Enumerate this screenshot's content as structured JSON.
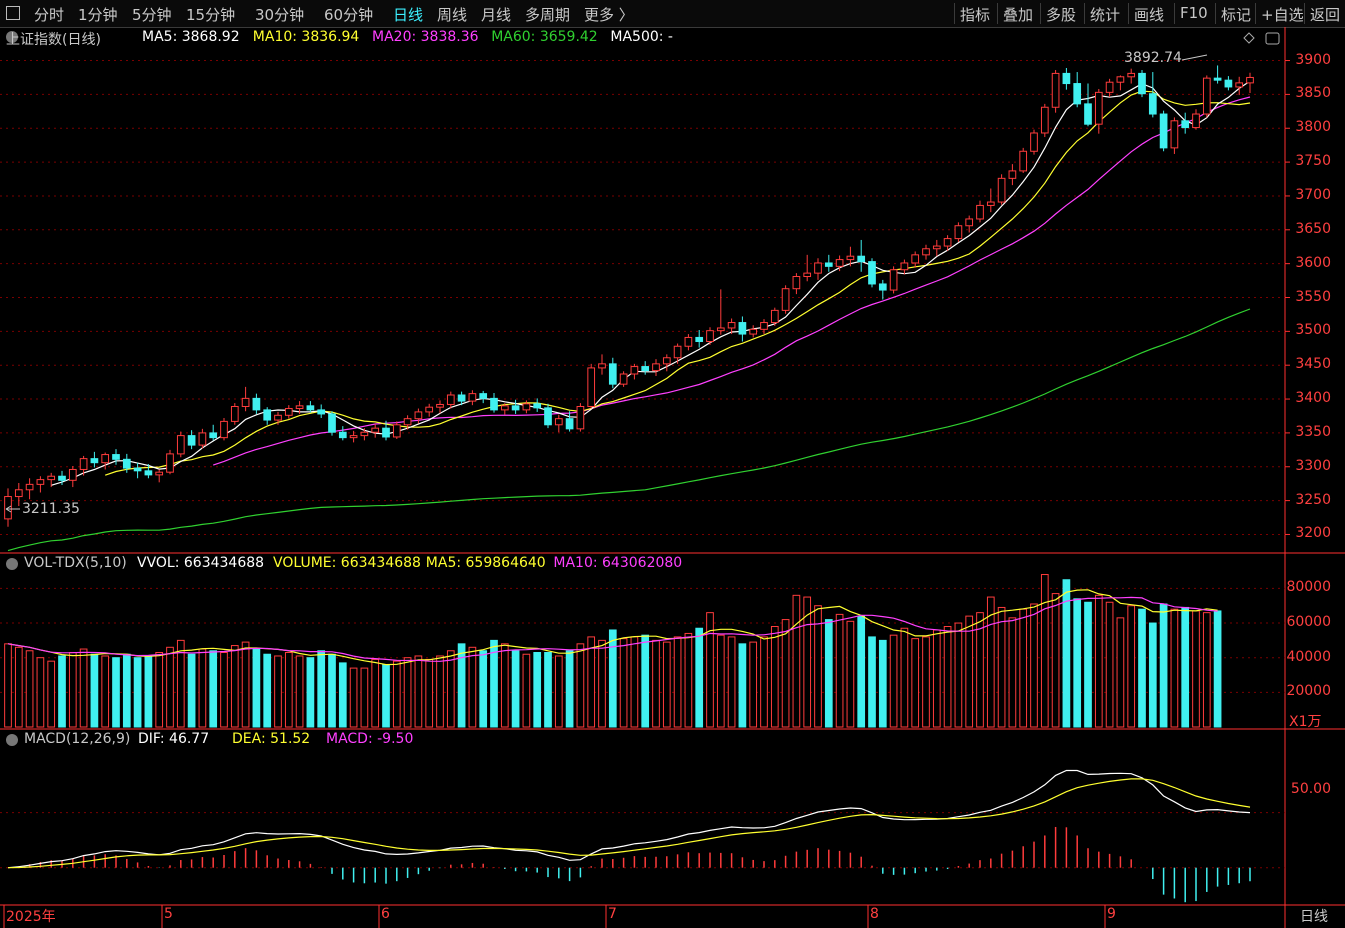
{
  "toolbar": {
    "left_items": [
      "分时",
      "1分钟",
      "5分钟",
      "15分钟",
      "30分钟",
      "60分钟",
      "日线",
      "周线",
      "月线",
      "多周期",
      "更多 〉"
    ],
    "active": "日线",
    "right_items": [
      "指标",
      "叠加",
      "多股",
      "统计",
      "画线",
      "F10",
      "标记",
      "+自选",
      "返回"
    ]
  },
  "main": {
    "title": "上证指数(日线)",
    "ma_labels": [
      {
        "text": "MA5: 3868.92",
        "color": "#ffffff"
      },
      {
        "text": "MA10: 3836.94",
        "color": "#ffff30"
      },
      {
        "text": "MA20: 3838.36",
        "color": "#ff40ff"
      },
      {
        "text": "MA60: 3659.42",
        "color": "#30d030"
      },
      {
        "text": "MA500: -",
        "color": "#ffffff"
      }
    ],
    "low_label": "3211.35",
    "high_label": "3892.74",
    "y_ticks": [
      "3900",
      "3850",
      "3800",
      "3750",
      "3700",
      "3650",
      "3600",
      "3550",
      "3500",
      "3450",
      "3400",
      "3350",
      "3300",
      "3250",
      "3200"
    ]
  },
  "volume": {
    "indicator_label": "VOL-TDX(5,10)",
    "labels": [
      {
        "text": "VVOL: 663434688",
        "color": "#ffffff"
      },
      {
        "text": "VOLUME: 663434688",
        "color": "#ffff30"
      },
      {
        "text": "MA5: 659864640",
        "color": "#ffff30"
      },
      {
        "text": "MA10: 643062080",
        "color": "#ff40ff"
      }
    ],
    "y_ticks": [
      "80000",
      "60000",
      "40000",
      "20000"
    ],
    "unit": "X1万"
  },
  "macd": {
    "indicator_label": "MACD(12,26,9)",
    "labels": [
      {
        "text": "DIF: 46.77",
        "color": "#ffffff"
      },
      {
        "text": "DEA: 51.52",
        "color": "#ffff30"
      },
      {
        "text": "MACD: -9.50",
        "color": "#ff40ff"
      }
    ],
    "y_tick": "50.00"
  },
  "x_axis": {
    "labels": [
      "2025年",
      "5",
      "6",
      "7",
      "8",
      "9"
    ],
    "period": "日线"
  },
  "colors": {
    "up": "#ff3c3c",
    "down": "#40f0f0",
    "grid": "#7a0000",
    "axis": "#ff3030"
  },
  "chart_data": {
    "type": "candlestick",
    "title": "上证指数(日线)",
    "ylim": [
      3180,
      3920
    ],
    "low_label": 3211.35,
    "high_label": 3892.74,
    "candles": [
      [
        3223,
        3268,
        3211.35,
        3256
      ],
      [
        3256,
        3276,
        3242,
        3266
      ],
      [
        3266,
        3283,
        3252,
        3274
      ],
      [
        3274,
        3286,
        3262,
        3281
      ],
      [
        3281,
        3291,
        3270,
        3286
      ],
      [
        3286,
        3294,
        3273,
        3280
      ],
      [
        3280,
        3301,
        3270,
        3296
      ],
      [
        3296,
        3316,
        3287,
        3312
      ],
      [
        3312,
        3322,
        3299,
        3306
      ],
      [
        3306,
        3321,
        3296,
        3318
      ],
      [
        3318,
        3326,
        3303,
        3311
      ],
      [
        3311,
        3319,
        3291,
        3298
      ],
      [
        3298,
        3306,
        3283,
        3294
      ],
      [
        3294,
        3304,
        3283,
        3288
      ],
      [
        3288,
        3296,
        3277,
        3292
      ],
      [
        3292,
        3325,
        3289,
        3319
      ],
      [
        3319,
        3352,
        3314,
        3346
      ],
      [
        3346,
        3354,
        3326,
        3332
      ],
      [
        3332,
        3356,
        3327,
        3350
      ],
      [
        3350,
        3362,
        3339,
        3343
      ],
      [
        3343,
        3372,
        3339,
        3367
      ],
      [
        3367,
        3394,
        3362,
        3389
      ],
      [
        3389,
        3418,
        3382,
        3401
      ],
      [
        3401,
        3408,
        3378,
        3384
      ],
      [
        3384,
        3388,
        3362,
        3369
      ],
      [
        3369,
        3381,
        3362,
        3376
      ],
      [
        3376,
        3391,
        3371,
        3386
      ],
      [
        3386,
        3397,
        3378,
        3390
      ],
      [
        3390,
        3397,
        3380,
        3384
      ],
      [
        3384,
        3392,
        3372,
        3378
      ],
      [
        3378,
        3382,
        3346,
        3351
      ],
      [
        3351,
        3360,
        3339,
        3343
      ],
      [
        3343,
        3353,
        3336,
        3346
      ],
      [
        3346,
        3357,
        3339,
        3351
      ],
      [
        3351,
        3363,
        3343,
        3357
      ],
      [
        3357,
        3368,
        3339,
        3344
      ],
      [
        3344,
        3367,
        3341,
        3362
      ],
      [
        3362,
        3376,
        3355,
        3371
      ],
      [
        3371,
        3386,
        3364,
        3381
      ],
      [
        3381,
        3393,
        3374,
        3388
      ],
      [
        3388,
        3398,
        3379,
        3392
      ],
      [
        3392,
        3411,
        3386,
        3406
      ],
      [
        3406,
        3411,
        3391,
        3397
      ],
      [
        3397,
        3413,
        3391,
        3408
      ],
      [
        3408,
        3412,
        3394,
        3401
      ],
      [
        3401,
        3409,
        3380,
        3384
      ],
      [
        3384,
        3394,
        3377,
        3390
      ],
      [
        3390,
        3399,
        3378,
        3384
      ],
      [
        3384,
        3398,
        3379,
        3393
      ],
      [
        3393,
        3401,
        3381,
        3387
      ],
      [
        3387,
        3393,
        3357,
        3362
      ],
      [
        3362,
        3377,
        3351,
        3371
      ],
      [
        3371,
        3382,
        3352,
        3356
      ],
      [
        3356,
        3394,
        3352,
        3389
      ],
      [
        3389,
        3452,
        3386,
        3446
      ],
      [
        3446,
        3466,
        3436,
        3452
      ],
      [
        3452,
        3461,
        3416,
        3422
      ],
      [
        3422,
        3441,
        3418,
        3437
      ],
      [
        3437,
        3452,
        3429,
        3448
      ],
      [
        3448,
        3456,
        3436,
        3442
      ],
      [
        3442,
        3459,
        3434,
        3452
      ],
      [
        3452,
        3466,
        3441,
        3461
      ],
      [
        3461,
        3482,
        3452,
        3478
      ],
      [
        3478,
        3496,
        3472,
        3491
      ],
      [
        3491,
        3502,
        3476,
        3485
      ],
      [
        3485,
        3506,
        3480,
        3501
      ],
      [
        3501,
        3562,
        3495,
        3505
      ],
      [
        3505,
        3519,
        3496,
        3513
      ],
      [
        3513,
        3522,
        3485,
        3496
      ],
      [
        3496,
        3509,
        3491,
        3503
      ],
      [
        3503,
        3518,
        3496,
        3513
      ],
      [
        3513,
        3535,
        3508,
        3531
      ],
      [
        3531,
        3568,
        3526,
        3563
      ],
      [
        3563,
        3586,
        3555,
        3581
      ],
      [
        3581,
        3613,
        3574,
        3586
      ],
      [
        3586,
        3608,
        3576,
        3601
      ],
      [
        3601,
        3613,
        3588,
        3596
      ],
      [
        3596,
        3612,
        3589,
        3606
      ],
      [
        3606,
        3625,
        3596,
        3611
      ],
      [
        3611,
        3635,
        3588,
        3603
      ],
      [
        3603,
        3608,
        3565,
        3570
      ],
      [
        3570,
        3576,
        3547,
        3561
      ],
      [
        3561,
        3596,
        3556,
        3591
      ],
      [
        3591,
        3606,
        3584,
        3601
      ],
      [
        3601,
        3618,
        3594,
        3613
      ],
      [
        3613,
        3628,
        3606,
        3622
      ],
      [
        3622,
        3635,
        3611,
        3626
      ],
      [
        3626,
        3642,
        3619,
        3637
      ],
      [
        3637,
        3661,
        3632,
        3656
      ],
      [
        3656,
        3671,
        3646,
        3666
      ],
      [
        3666,
        3693,
        3661,
        3686
      ],
      [
        3686,
        3711,
        3676,
        3691
      ],
      [
        3691,
        3732,
        3687,
        3726
      ],
      [
        3726,
        3747,
        3716,
        3737
      ],
      [
        3737,
        3771,
        3734,
        3766
      ],
      [
        3766,
        3798,
        3761,
        3793
      ],
      [
        3793,
        3836,
        3787,
        3831
      ],
      [
        3831,
        3886,
        3823,
        3881
      ],
      [
        3881,
        3889,
        3857,
        3866
      ],
      [
        3866,
        3883,
        3831,
        3836
      ],
      [
        3836,
        3866,
        3803,
        3806
      ],
      [
        3806,
        3858,
        3792,
        3853
      ],
      [
        3853,
        3873,
        3846,
        3868
      ],
      [
        3868,
        3878,
        3856,
        3876
      ],
      [
        3876,
        3888,
        3866,
        3881
      ],
      [
        3881,
        3886,
        3846,
        3851
      ],
      [
        3851,
        3883,
        3816,
        3821
      ],
      [
        3821,
        3826,
        3766,
        3771
      ],
      [
        3771,
        3816,
        3762,
        3811
      ],
      [
        3811,
        3823,
        3792,
        3801
      ],
      [
        3801,
        3828,
        3798,
        3821
      ],
      [
        3821,
        3878,
        3816,
        3874
      ],
      [
        3874,
        3892.74,
        3866,
        3871
      ],
      [
        3871,
        3877,
        3856,
        3861
      ],
      [
        3861,
        3876,
        3849,
        3867
      ],
      [
        3867,
        3882,
        3852,
        3875
      ]
    ],
    "ma": {
      "MA5": 3868.92,
      "MA10": 3836.94,
      "MA20": 3838.36,
      "MA60": 3659.42
    },
    "volume_unit": "万",
    "volume_ylim": [
      0,
      86000
    ],
    "volume": [
      48000,
      46000,
      44000,
      40000,
      38000,
      41000,
      43000,
      45000,
      42000,
      41000,
      40000,
      42000,
      40000,
      41000,
      43000,
      46000,
      50000,
      42000,
      45000,
      44000,
      43000,
      47000,
      49000,
      45000,
      42000,
      41000,
      43000,
      41000,
      40000,
      44000,
      42000,
      37000,
      34000,
      34000,
      39000,
      36000,
      38000,
      40000,
      41000,
      39000,
      41000,
      44000,
      48000,
      46000,
      44000,
      50000,
      48000,
      44000,
      42000,
      43000,
      43000,
      41000,
      44000,
      48000,
      52000,
      50000,
      56000,
      51000,
      52000,
      53000,
      50000,
      49000,
      52000,
      54000,
      57000,
      66000,
      53000,
      52000,
      48000,
      49000,
      52000,
      58000,
      62000,
      76000,
      75000,
      70000,
      62000,
      65000,
      61000,
      64000,
      52000,
      50000,
      53000,
      57000,
      51000,
      52000,
      56000,
      58000,
      60000,
      64000,
      66000,
      75000,
      69000,
      63000,
      68000,
      71000,
      88000,
      77000,
      85000,
      74000,
      72000,
      76000,
      72000,
      63000,
      70000,
      68000,
      60000,
      71000,
      68000,
      69000,
      67000,
      66000,
      67000
    ],
    "macd_ylim": [
      -30,
      100
    ],
    "DIF": 46.77,
    "DEA": 51.52,
    "MACD": -9.5,
    "x_labels": [
      "2025年",
      "5",
      "6",
      "7",
      "8",
      "9"
    ]
  }
}
